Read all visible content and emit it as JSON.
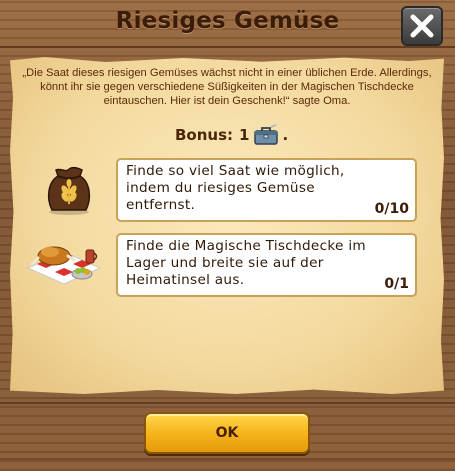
{
  "dialog": {
    "title": "Riesiges Gemüse",
    "intro": "„Die Saat dieses riesigen Gemüses wächst nicht in einer üblichen Erde. Allerdings, könnt ihr sie gegen verschiedene Süßigkeiten in der Magischen Tischdecke eintauschen. Hier ist dein Geschenk!“ sagte Oma.",
    "bonus_label": "Bonus:",
    "bonus_value": "1",
    "bonus_suffix": ".",
    "bonus_icon": "toolbox-icon",
    "ok_label": "OK"
  },
  "tasks": [
    {
      "text": "Finde so viel Saat wie möglich, indem du riesiges Gemüse entfernst.",
      "progress": "0/10",
      "icon": "seed-sack-icon"
    },
    {
      "text": "Finde die Magische Tischdecke im Lager und breite sie auf der Heimatinsel aus.",
      "progress": "0/1",
      "icon": "picnic-tablecloth-icon"
    }
  ],
  "colors": {
    "wood": "#7d5230",
    "parchment": "#f3d99e",
    "ok_button": "#f5b21a",
    "title_text": "#3b1c08"
  }
}
